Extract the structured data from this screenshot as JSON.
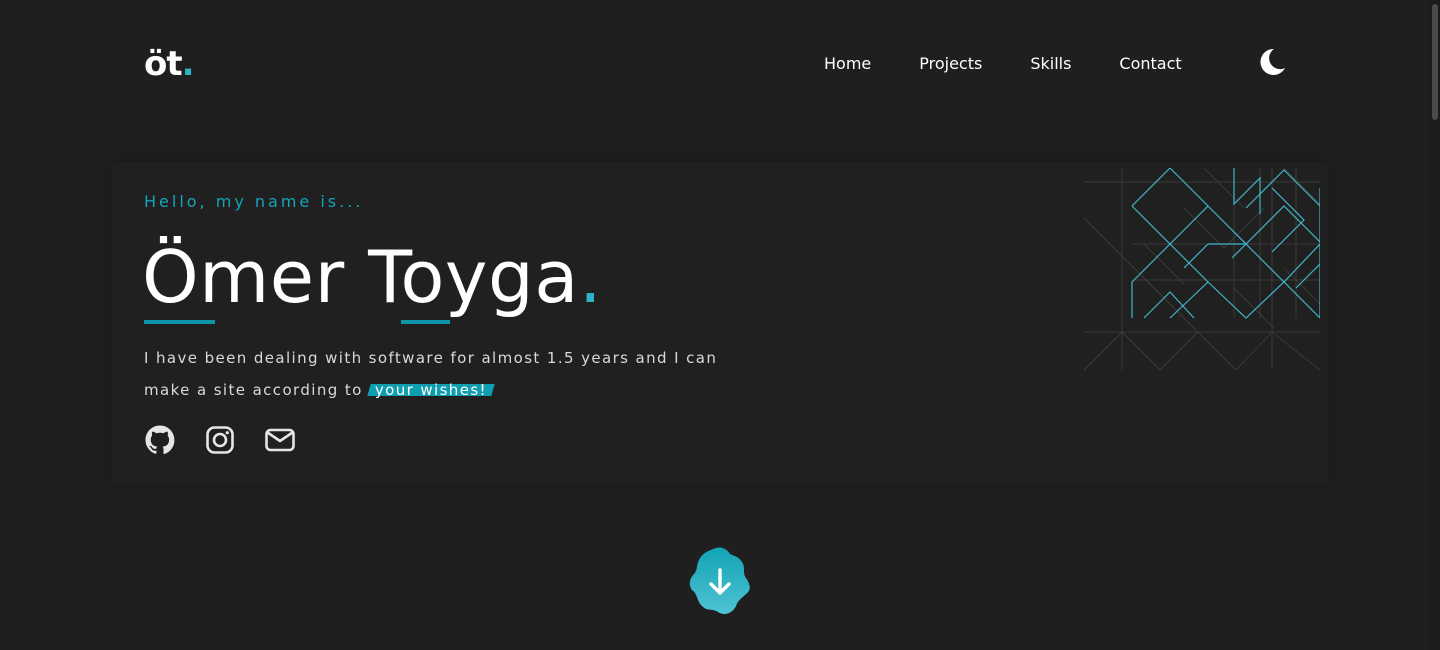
{
  "logo": {
    "text": "öt",
    "dot": "."
  },
  "nav": {
    "links": [
      "Home",
      "Projects",
      "Skills",
      "Contact"
    ]
  },
  "theme_toggle": {
    "icon": "moon-icon"
  },
  "hero": {
    "greeting": "Hello, my name is...",
    "name": "Ömer Toyga",
    "name_dot": ".",
    "bio_prefix": "I have been dealing with software for almost 1.5 years and I can make a site according to",
    "bio_highlight": "your wishes!"
  },
  "socials": [
    "github-icon",
    "instagram-icon",
    "mail-icon"
  ],
  "colors": {
    "background": "#1f1f1f",
    "accent": "#0f9db0",
    "text": "#ffffff"
  }
}
